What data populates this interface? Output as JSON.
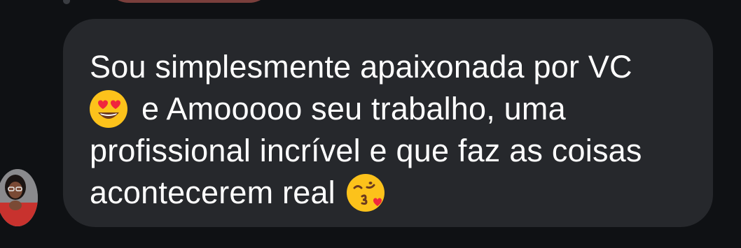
{
  "message": {
    "segment_1": "Sou simplesmente apaixonada por VC",
    "emoji_1": "heart-eyes-emoji",
    "segment_2": "e Amooooo seu trabalho, uma",
    "segment_3": "profissional incrível e que faz as coisas",
    "segment_4": "acontecerem real",
    "emoji_2": "kissing-heart-emoji"
  },
  "colors": {
    "background": "#0f1114",
    "bubble": "#26282c",
    "text": "#ffffff"
  }
}
